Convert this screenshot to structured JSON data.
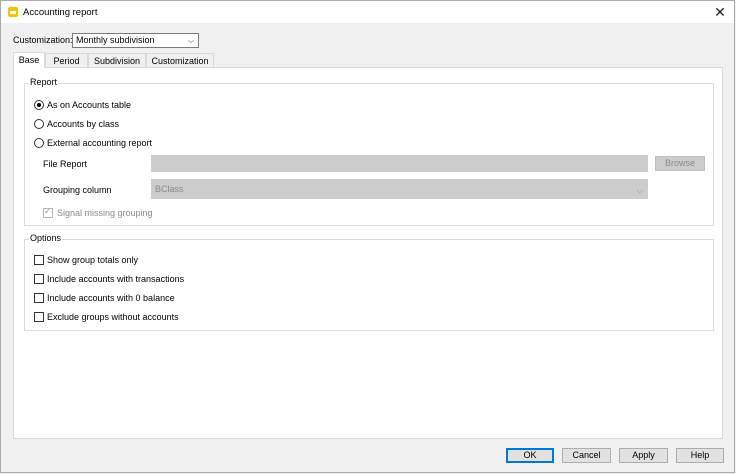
{
  "window": {
    "title": "Accounting report"
  },
  "customization": {
    "label": "Customization:",
    "value": "Monthly subdivision"
  },
  "tabs": [
    {
      "label": "Base"
    },
    {
      "label": "Period"
    },
    {
      "label": "Subdivision"
    },
    {
      "label": "Customization"
    }
  ],
  "report": {
    "title": "Report",
    "options": [
      {
        "label": "As on Accounts table",
        "checked": true
      },
      {
        "label": "Accounts by class",
        "checked": false
      },
      {
        "label": "External accounting report",
        "checked": false
      }
    ],
    "file_report_label": "File Report",
    "browse_label": "Browse",
    "grouping_label": "Grouping column",
    "grouping_value": "BClass",
    "signal_missing_label": "Signal missing grouping"
  },
  "options": {
    "title": "Options",
    "items": [
      {
        "label": "Show group totals only"
      },
      {
        "label": "Include accounts with transactions"
      },
      {
        "label": "Include accounts with 0 balance"
      },
      {
        "label": "Exclude groups without accounts"
      }
    ]
  },
  "buttons": {
    "ok": "OK",
    "cancel": "Cancel",
    "apply": "Apply",
    "help": "Help"
  },
  "colors": {
    "accent": "#0078d7",
    "app_icon": "#f5c400"
  }
}
